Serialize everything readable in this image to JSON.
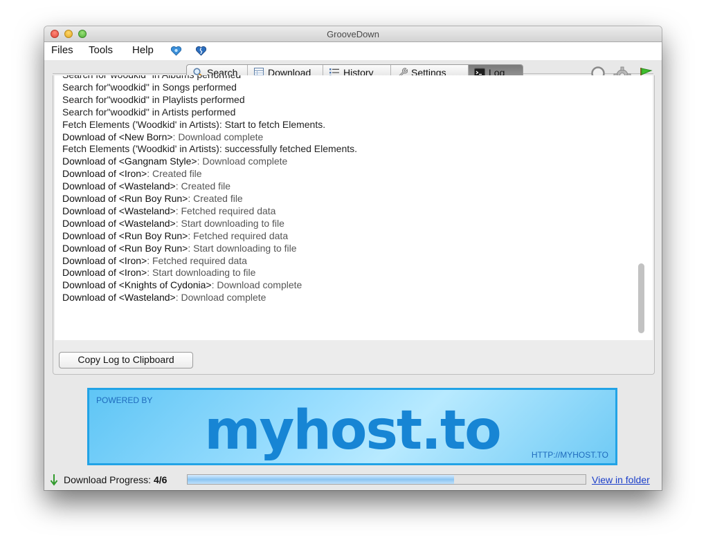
{
  "window": {
    "title": "GrooveDown"
  },
  "menubar": {
    "items": [
      "Files",
      "Tools",
      "Help"
    ],
    "icons": [
      "heart-globe-icon",
      "broken-heart-icon"
    ]
  },
  "tabs": [
    {
      "label": "Search",
      "icon": "magnifier-icon"
    },
    {
      "label": "Download",
      "icon": "table-icon"
    },
    {
      "label": "History",
      "icon": "list-icon"
    },
    {
      "label": "Settings",
      "icon": "wrench-icon"
    },
    {
      "label": "Log",
      "icon": "terminal-icon",
      "active": true
    }
  ],
  "toolbar_right": [
    "search-zoom-icon",
    "gear-icon",
    "green-flag-icon"
  ],
  "log": {
    "lines": [
      {
        "bold": "",
        "rest": "Search for\"woodkid\" in Albums performed"
      },
      {
        "bold": "",
        "rest": "Search for\"woodkid\" in Songs performed"
      },
      {
        "bold": "",
        "rest": "Search for\"woodkid\" in Playlists performed"
      },
      {
        "bold": "",
        "rest": "Search for\"woodkid\" in Artists performed"
      },
      {
        "bold": "",
        "rest": "Fetch Elements ('Woodkid' in Artists): Start to fetch Elements."
      },
      {
        "bold": "Download of <New Born>",
        "rest": ": Download complete"
      },
      {
        "bold": "",
        "rest": "Fetch Elements ('Woodkid' in Artists): successfully fetched Elements."
      },
      {
        "bold": "Download of <Gangnam Style>",
        "rest": ": Download complete"
      },
      {
        "bold": "Download of <Iron>",
        "rest": ": Created file"
      },
      {
        "bold": "Download of <Wasteland>",
        "rest": ": Created file"
      },
      {
        "bold": "Download of <Run Boy Run>",
        "rest": ": Created file"
      },
      {
        "bold": "Download of <Wasteland>",
        "rest": ": Fetched required data"
      },
      {
        "bold": "Download of <Wasteland>",
        "rest": ": Start downloading to file"
      },
      {
        "bold": "Download of <Run Boy Run>",
        "rest": ": Fetched required data"
      },
      {
        "bold": "Download of <Run Boy Run>",
        "rest": ": Start downloading to file"
      },
      {
        "bold": "Download of <Iron>",
        "rest": ": Fetched required data"
      },
      {
        "bold": "Download of <Iron>",
        "rest": ": Start downloading to file"
      },
      {
        "bold": "Download of <Knights of Cydonia>",
        "rest": ": Download complete"
      },
      {
        "bold": "Download of <Wasteland>",
        "rest": ": Download complete"
      }
    ],
    "copy_button": "Copy Log to Clipboard"
  },
  "banner": {
    "powered_by": "POWERED BY",
    "brand": "myhost.to",
    "url": "HTTP://MYHOST.TO"
  },
  "status": {
    "label": "Download Progress:",
    "count": "4/6",
    "progress": 0.67,
    "view_folder": "View in folder"
  },
  "colors": {
    "accent_blue": "#22a3e6",
    "link": "#1a3ec9"
  }
}
